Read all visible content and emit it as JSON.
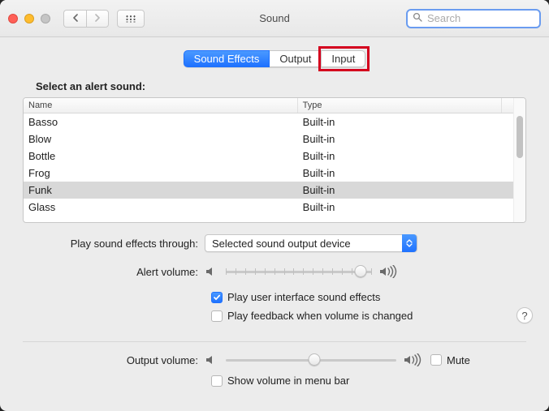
{
  "window": {
    "title": "Sound"
  },
  "search": {
    "placeholder": "Search"
  },
  "tabs": [
    {
      "label": "Sound Effects"
    },
    {
      "label": "Output"
    },
    {
      "label": "Input"
    }
  ],
  "alerts": {
    "section_title": "Select an alert sound:",
    "columns": {
      "name": "Name",
      "type": "Type"
    },
    "rows": [
      {
        "name": "Basso",
        "type": "Built-in",
        "selected": false
      },
      {
        "name": "Blow",
        "type": "Built-in",
        "selected": false
      },
      {
        "name": "Bottle",
        "type": "Built-in",
        "selected": false
      },
      {
        "name": "Frog",
        "type": "Built-in",
        "selected": false
      },
      {
        "name": "Funk",
        "type": "Built-in",
        "selected": true
      },
      {
        "name": "Glass",
        "type": "Built-in",
        "selected": false
      }
    ]
  },
  "effects_through": {
    "label": "Play sound effects through:",
    "value": "Selected sound output device"
  },
  "alert_volume": {
    "label": "Alert volume:",
    "percent": 92
  },
  "options": {
    "ui_sounds": {
      "label": "Play user interface sound effects",
      "checked": true
    },
    "feedback": {
      "label": "Play feedback when volume is changed",
      "checked": false
    }
  },
  "output_volume": {
    "label": "Output volume:",
    "percent": 52,
    "mute_label": "Mute",
    "mute_checked": false
  },
  "menubar": {
    "label": "Show volume in menu bar",
    "checked": false
  },
  "help": {
    "glyph": "?"
  }
}
